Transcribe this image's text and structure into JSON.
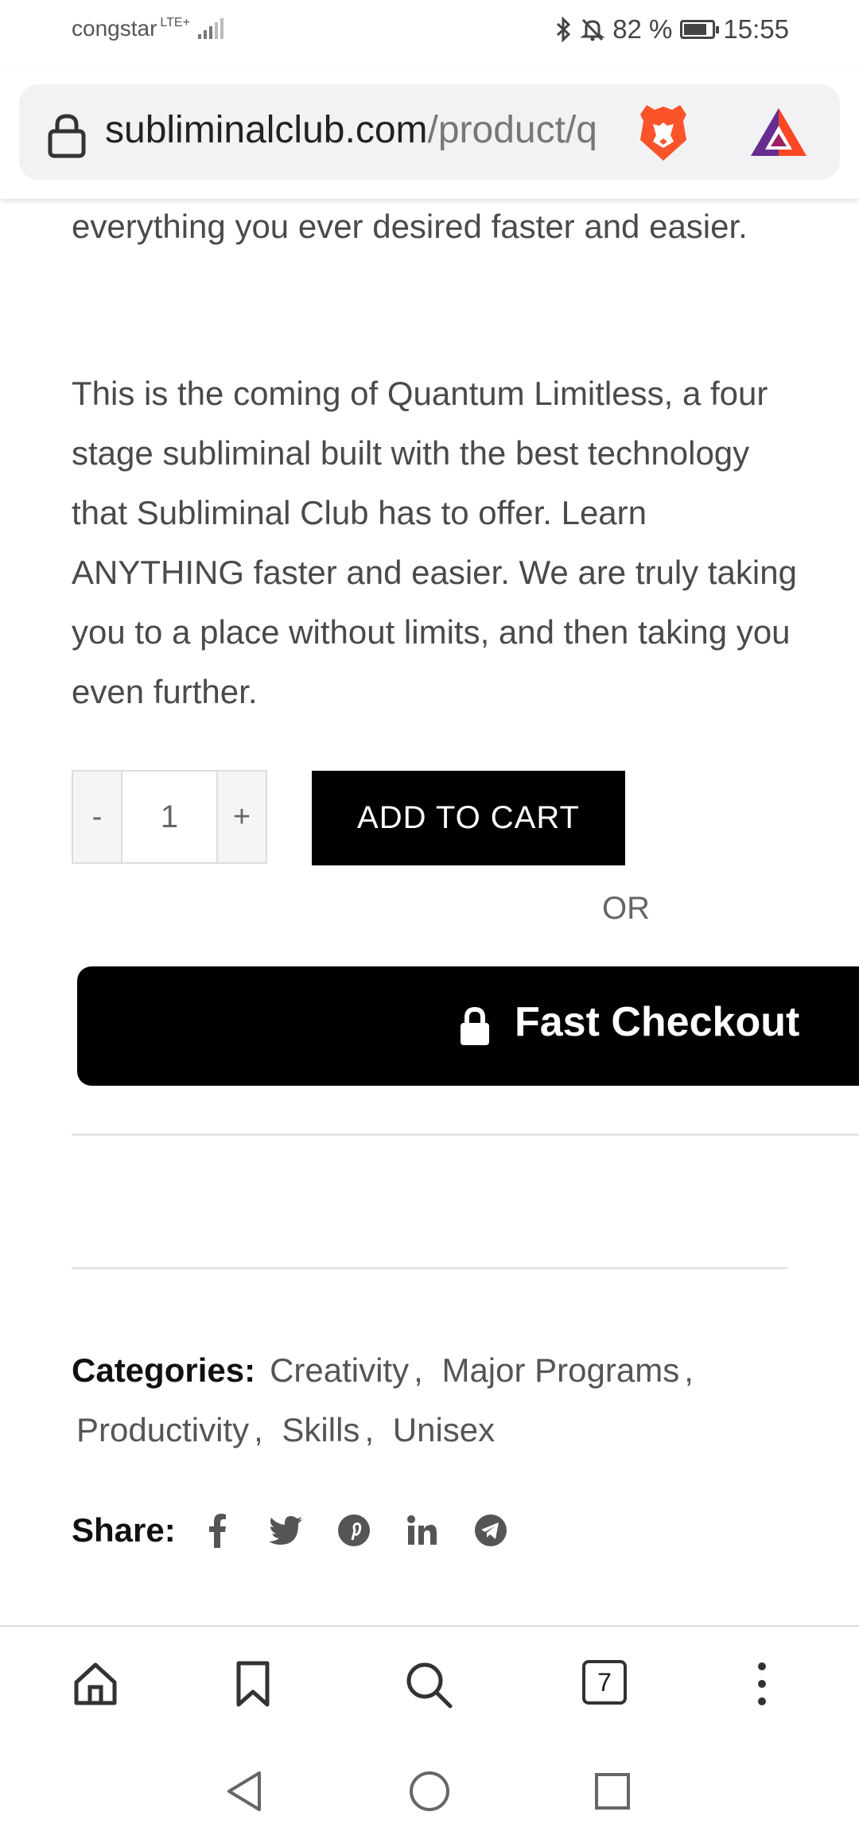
{
  "status_bar": {
    "carrier": "congstar",
    "network": "LTE+",
    "battery_percent": "82 %",
    "battery_level": 0.82,
    "time": "15:55"
  },
  "browser": {
    "url_domain": "subliminalclub.com",
    "url_path": "/product/q",
    "tab_count": "7"
  },
  "product": {
    "paragraph_1": "everything you ever desired faster and easier.",
    "paragraph_2": "This is the coming of Quantum Limitless, a four stage subliminal built with the best technology that Subliminal Club has to offer. Learn ANYTHING faster and easier. We are truly taking you to a place without limits, and then taking you even further.",
    "quantity": {
      "minus_label": "-",
      "value": "1",
      "plus_label": "+"
    },
    "add_to_cart_label": "ADD TO CART",
    "or_label": "OR",
    "fast_checkout_label": "Fast Checkout"
  },
  "meta": {
    "categories_label": "Categories:",
    "categories": [
      "Creativity",
      "Major Programs",
      "Productivity",
      "Skills",
      "Unisex"
    ],
    "share_label": "Share:",
    "share_icons": [
      "facebook-icon",
      "twitter-icon",
      "pinterest-icon",
      "linkedin-icon",
      "telegram-icon"
    ]
  },
  "colors": {
    "button_bg": "#000000",
    "text": "#4a4a4a",
    "brave_orange": "#fb542b"
  }
}
